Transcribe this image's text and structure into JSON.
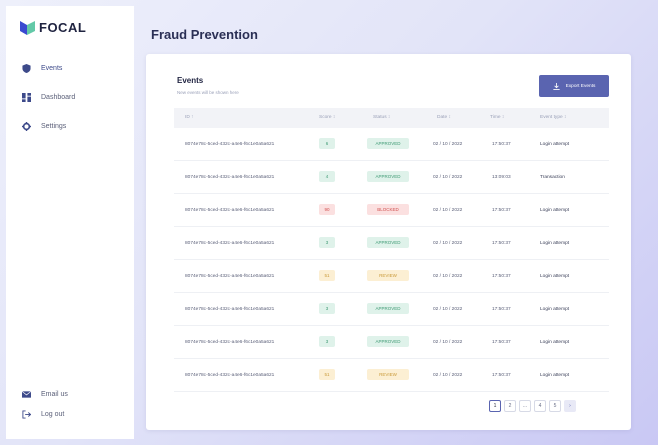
{
  "app": {
    "name": "FOCAL"
  },
  "sidebar": {
    "items": [
      {
        "label": "Events",
        "icon": "shield-icon",
        "active": true
      },
      {
        "label": "Dashboard",
        "icon": "grid-icon",
        "active": false
      },
      {
        "label": "Settings",
        "icon": "gear-icon",
        "active": false
      }
    ],
    "footer": [
      {
        "label": "Email us",
        "icon": "mail-icon"
      },
      {
        "label": "Log out",
        "icon": "logout-icon"
      }
    ]
  },
  "page": {
    "title": "Fraud Prevention"
  },
  "events": {
    "title": "Events",
    "subtitle": "New events will be shown here",
    "export_label": "Export Events",
    "columns": [
      "ID ↑",
      "Score ↕",
      "Status ↕",
      "Date ↕",
      "Time ↕",
      "Event type ↕"
    ],
    "rows": [
      {
        "id": "8074e78c-5ced-432c-a4e6-f6c1e0a5a621",
        "score": "6",
        "status": "APPROVED",
        "date": "02 / 10 / 2022",
        "time": "17:50:37",
        "type": "Login attempt",
        "tone": "green"
      },
      {
        "id": "8074e78c-5ced-432c-a4e6-f6c1e0a5a621",
        "score": "4",
        "status": "APPROVED",
        "date": "02 / 10 / 2022",
        "time": "13:09:03",
        "type": "Transaction",
        "tone": "green"
      },
      {
        "id": "8074e78c-5ced-432c-a4e6-f6c1e0a5a621",
        "score": "90",
        "status": "BLOCKED",
        "date": "02 / 10 / 2022",
        "time": "17:50:37",
        "type": "Login attempt",
        "tone": "red"
      },
      {
        "id": "8074e78c-5ced-432c-a4e6-f6c1e0a5a621",
        "score": "3",
        "status": "APPROVED",
        "date": "02 / 10 / 2022",
        "time": "17:50:37",
        "type": "Login attempt",
        "tone": "green"
      },
      {
        "id": "8074e78c-5ced-432c-a4e6-f6c1e0a5a621",
        "score": "51",
        "status": "REVIEW",
        "date": "02 / 10 / 2022",
        "time": "17:50:37",
        "type": "Login attempt",
        "tone": "yellow"
      },
      {
        "id": "8074e78c-5ced-432c-a4e6-f6c1e0a5a621",
        "score": "3",
        "status": "APPROVED",
        "date": "02 / 10 / 2022",
        "time": "17:50:37",
        "type": "Login attempt",
        "tone": "green"
      },
      {
        "id": "8074e78c-5ced-432c-a4e6-f6c1e0a5a621",
        "score": "3",
        "status": "APPROVED",
        "date": "02 / 10 / 2022",
        "time": "17:50:37",
        "type": "Login attempt",
        "tone": "green"
      },
      {
        "id": "8074e78c-5ced-432c-a4e6-f6c1e0a5a621",
        "score": "51",
        "status": "REVIEW",
        "date": "02 / 10 / 2022",
        "time": "17:50:37",
        "type": "Login attempt",
        "tone": "yellow"
      }
    ],
    "pagination": [
      "1",
      "2",
      "...",
      "4",
      "5",
      "›"
    ]
  },
  "colors": {
    "accent": "#5a64b0",
    "green_bg": "#dff2ea",
    "green_fg": "#3f9a74",
    "red_bg": "#fbe0e0",
    "red_fg": "#d0504f",
    "yellow_bg": "#fcefd3",
    "yellow_fg": "#c99a3a"
  }
}
